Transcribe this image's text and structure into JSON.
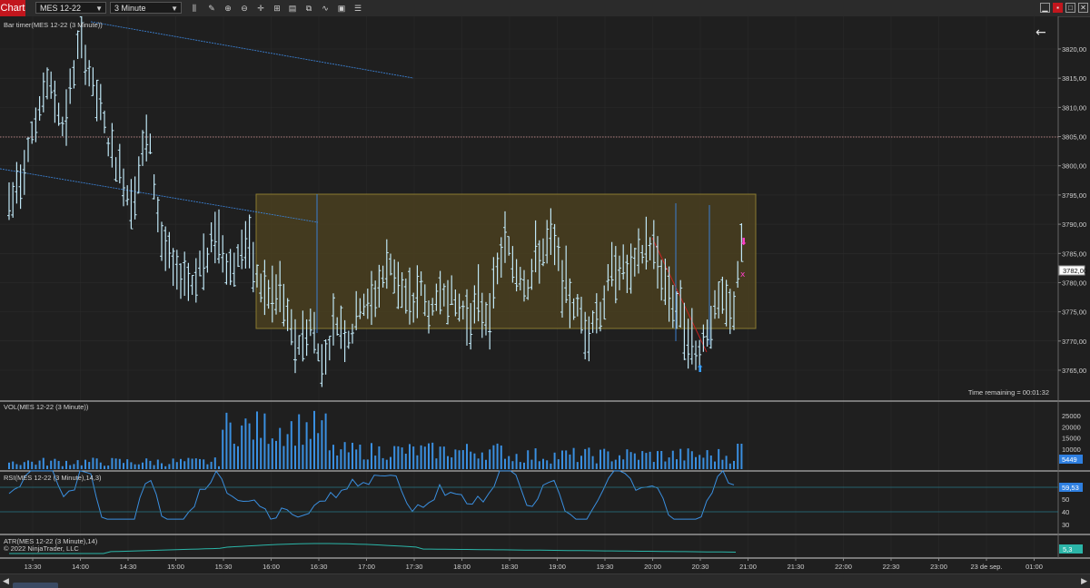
{
  "toolbar": {
    "tab_label": "Chart",
    "instrument": "MES 12-22",
    "interval": "3 Minute",
    "tools": [
      "bars-icon",
      "pencil-icon",
      "zoom-in-icon",
      "zoom-out-icon",
      "crosshair-icon",
      "data-box-icon",
      "chart-style-icon",
      "draw-icon",
      "properties-icon",
      "list-icon"
    ]
  },
  "colors": {
    "background": "#1f1f1f",
    "bar": "#bfe6f5",
    "zone_fill": "#4a4020",
    "zone_stroke": "#8a7a30",
    "trend": "#3b7fd0",
    "volume": "#3a8fe0",
    "rsi": "#3a8fe0",
    "atr": "#2bb5a8",
    "price_tag": "#ffffff",
    "accent_blue": "#2e7fe0"
  },
  "price_panel": {
    "label": "Bar timer(MES 12-22 (3 Minute))",
    "time_remaining": "Time remaining = 00:01:32",
    "current_price": "3782,00",
    "y_ticks": [
      "3820,00",
      "3815,00",
      "3810,00",
      "3805,00",
      "3800,00",
      "3795,00",
      "3790,00",
      "3785,00",
      "3780,00",
      "3775,00",
      "3770,00",
      "3765,00"
    ],
    "y_range": [
      3762,
      3825
    ]
  },
  "volume_panel": {
    "label": "VOL(MES 12-22 (3 Minute))",
    "y_ticks": [
      "25000",
      "20000",
      "15000",
      "10000"
    ],
    "current": "5449"
  },
  "rsi_panel": {
    "label": "RSI(MES 12-22 (3 Minute),14,3)",
    "y_ticks": [
      "50",
      "40",
      "30"
    ],
    "current": "59,53"
  },
  "atr_panel": {
    "label": "ATR(MES 12-22 (3 Minute),14)",
    "copyright": "© 2022 NinjaTrader, LLC",
    "current": "5,3"
  },
  "x_axis": {
    "ticks": [
      "13:30",
      "14:00",
      "14:30",
      "15:00",
      "15:30",
      "16:00",
      "16:30",
      "17:00",
      "17:30",
      "18:00",
      "18:30",
      "19:00",
      "19:30",
      "20:00",
      "20:30",
      "21:00",
      "21:30",
      "22:00",
      "22:30",
      "23:00",
      "23 de sep.",
      "01:00"
    ]
  },
  "bottom_tab": "MES 12-22"
}
